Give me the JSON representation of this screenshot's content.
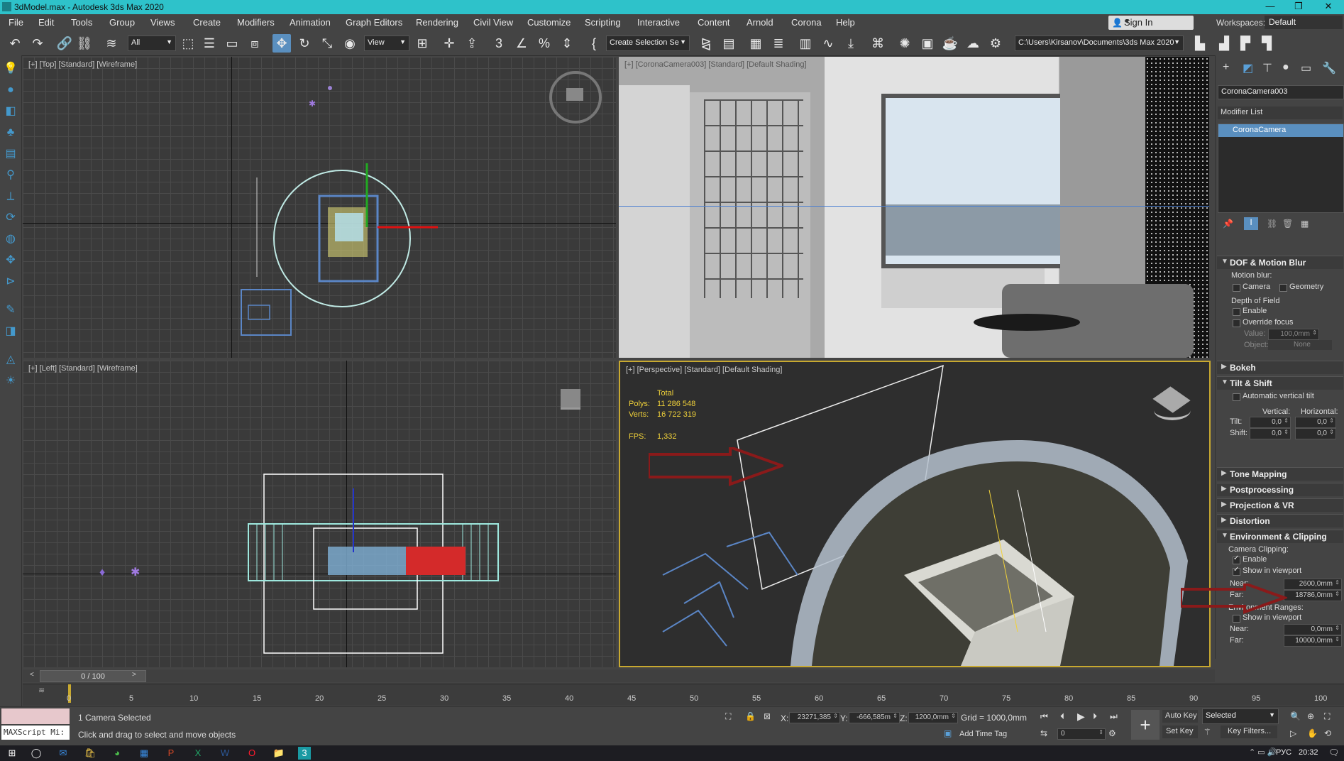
{
  "window": {
    "title": "3dModel.max - Autodesk 3ds Max 2020",
    "min": "—",
    "max": "❐",
    "close": "✕"
  },
  "menu": [
    "File",
    "Edit",
    "Tools",
    "Group",
    "Views",
    "Create",
    "Modifiers",
    "Animation",
    "Graph Editors",
    "Rendering",
    "Civil View",
    "Customize",
    "Scripting",
    "Interactive",
    "Content",
    "Arnold",
    "Corona",
    "Help"
  ],
  "account": {
    "sign_in": "Sign In",
    "workspaces_label": "Workspaces:",
    "workspace_value": "Default"
  },
  "toolbar": {
    "selection_filter": "All",
    "ref_coord": "View",
    "named_selection": "Create Selection Se",
    "project_path": "C:\\Users\\Kirsanov\\Documents\\3ds Max 2020"
  },
  "viewports": {
    "top": {
      "label": "[+] [Top] [Standard] [Wireframe]"
    },
    "camera": {
      "label": "[+] [CoronaCamera003] [Standard] [Default Shading]"
    },
    "left": {
      "label": "[+] [Left] [Standard] [Wireframe]"
    },
    "perspective": {
      "label": "[+] [Perspective] [Standard] [Default Shading]",
      "stats": {
        "total_label": "Total",
        "polys_label": "Polys:",
        "polys": "11 286 548",
        "verts_label": "Verts:",
        "verts": "16 722 319",
        "fps_label": "FPS:",
        "fps": "1,332"
      }
    }
  },
  "command_panel": {
    "object_name": "CoronaCamera003",
    "modifier_list": "Modifier List",
    "stack_item": "CoronaCamera",
    "dof": {
      "title": "DOF & Motion Blur",
      "motion_blur": "Motion blur:",
      "camera": "Camera",
      "geometry": "Geometry",
      "depth_of_field": "Depth of Field",
      "enable": "Enable",
      "override_focus": "Override focus",
      "value_label": "Value:",
      "value": "100,0mm",
      "object_label": "Object:",
      "object_value": "None"
    },
    "bokeh": "Bokeh",
    "tilt_shift": {
      "title": "Tilt & Shift",
      "auto_vertical": "Automatic vertical tilt",
      "vertical": "Vertical:",
      "horizontal": "Horizontal:",
      "tilt_label": "Tilt:",
      "tilt_v": "0,0",
      "tilt_h": "0,0",
      "shift_label": "Shift:",
      "shift_v": "0,0",
      "shift_h": "0,0"
    },
    "tone_mapping": "Tone Mapping",
    "postprocessing": "Postprocessing",
    "projection_vr": "Projection & VR",
    "distortion": "Distortion",
    "env_clip": {
      "title": "Environment & Clipping",
      "camera_clipping": "Camera Clipping:",
      "enable": "Enable",
      "show_in_viewport": "Show in viewport",
      "near_label": "Near:",
      "near": "2600,0mm",
      "far_label": "Far:",
      "far": "18786,0mm",
      "env_ranges": "Environment Ranges:",
      "show_in_viewport2": "Show in viewport",
      "near2_label": "Near:",
      "near2": "0,0mm",
      "far2_label": "Far:",
      "far2": "10000,0mm"
    }
  },
  "timeline": {
    "frame_display": "0 / 100",
    "ticks": [
      "0",
      "5",
      "10",
      "15",
      "20",
      "25",
      "30",
      "35",
      "40",
      "45",
      "50",
      "55",
      "60",
      "65",
      "70",
      "75",
      "80",
      "85",
      "90",
      "95",
      "100"
    ]
  },
  "status": {
    "maxscript": "MAXScript Mi:",
    "selection": "1 Camera Selected",
    "prompt": "Click and drag to select and move objects",
    "x_label": "X:",
    "x": "23271,385",
    "y_label": "Y:",
    "y": "-666,585m",
    "z_label": "Z:",
    "z": "1200,0mm",
    "grid": "Grid = 1000,0mm",
    "add_time_tag": "Add Time Tag",
    "frame": "0",
    "auto_key": "Auto Key",
    "key_mode": "Selected",
    "set_key": "Set Key",
    "key_filters": "Key Filters..."
  },
  "taskbar": {
    "lang": "РУС",
    "time": "20:32"
  },
  "colors": {
    "title_bar": "#2ec2ca",
    "accent_blue": "#5a8fbf",
    "stats_yellow": "#f0d13a",
    "arrow_red": "#8a1a1a"
  }
}
